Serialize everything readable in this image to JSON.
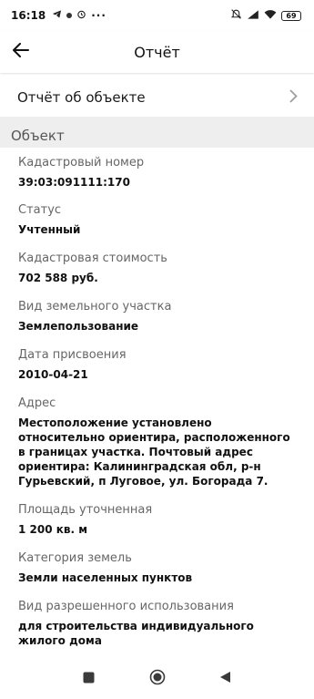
{
  "status_bar": {
    "time": "16:18",
    "battery": "69"
  },
  "app_bar": {
    "title": "Отчёт"
  },
  "report_row": {
    "label": "Отчёт об объекте"
  },
  "section": {
    "title": "Объект"
  },
  "fields": [
    {
      "label": "Кадастровый номер",
      "value": "39:03:091111:170"
    },
    {
      "label": "Статус",
      "value": "Учтенный"
    },
    {
      "label": "Кадастровая стоимость",
      "value": "702 588 руб."
    },
    {
      "label": "Вид земельного участка",
      "value": "Землепользование"
    },
    {
      "label": "Дата присвоения",
      "value": "2010-04-21"
    },
    {
      "label": "Адрес",
      "value": "Местоположение установлено относительно ориентира, расположенного в границах участка. Почтовый адрес ориентира: Калининградская обл, р-н Гурьевский, п Луговое, ул. Богорада 7."
    },
    {
      "label": "Площадь уточненная",
      "value": "1 200 кв. м"
    },
    {
      "label": "Категория земель",
      "value": "Земли населенных пунктов"
    },
    {
      "label": "Вид разрешенного использования",
      "value": "для строительства индивидуального жилого дома"
    }
  ]
}
